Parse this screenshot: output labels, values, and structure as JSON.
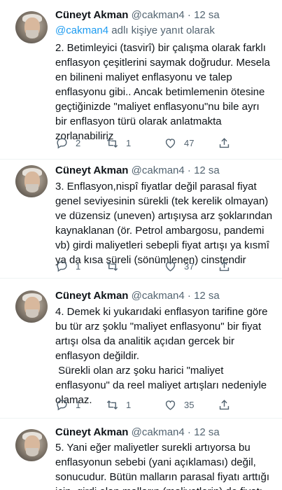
{
  "tweets": [
    {
      "name": "Cüneyt Akman",
      "handle": "@cakman4",
      "time": "· 12 sa",
      "replying_prefix": "@cakman4",
      "replying_suffix": " adlı kişiye yanıt olarak",
      "text": "2. Betimleyici (tasvirî) bir çalışma olarak farklı\nenflasyon çeşitlerini saymak doğrudur. Mesela\nen bilineni maliyet enflasyonu ve talep\nenflasyonu gibi.. Ancak betimlemenin ötesine\ngeçtiğinizde \"maliyet enflasyonu\"nu bile ayrı\nbir enflasyon türü olarak anlatmakta\nzorlanabiliriz",
      "replies": "2",
      "retweets": "1",
      "likes": "47"
    },
    {
      "name": "Cüneyt Akman",
      "handle": "@cakman4",
      "time": "· 12 sa",
      "text": "3. Enflasyon,nispî fiyatlar değil parasal fiyat\ngenel seviyesinin sürekli (tek kerelik olmayan)\nve düzensiz (uneven) artışıysa arz şoklarından\nkaynaklanan (ör. Petrol ambargosu, pandemi\nvb) girdi maliyetleri sebepli fiyat artışı ya kısmî\nya da kısa süreli (sönümlenen) cinstendir",
      "replies": "1",
      "retweets": "",
      "likes": "37"
    },
    {
      "name": "Cüneyt Akman",
      "handle": "@cakman4",
      "time": "· 12 sa",
      "text": "4. Demek ki yukarıdaki enflasyon tarifine göre\nbu tür arz şoklu \"maliyet enflasyonu\" bir fiyat\nartışı olsa da analitik açıdan gercek bir\nenflasyon değildir.\n Sürekli olan arz şoku harici \"maliyet\nenflasyonu\" da reel maliyet artışları nedeniyle\nolamaz.",
      "replies": "1",
      "retweets": "1",
      "likes": "35"
    },
    {
      "name": "Cüneyt Akman",
      "handle": "@cakman4",
      "time": "· 12 sa",
      "text": "5. Yani eğer maliyetler surekli artıyorsa bu\nenflasyonun sebebi (yani açıklaması) değil,\nsonucudur. Bütün malların parasal fiyatı arttığı\niçin, girdi olan malların (maliyetlerin) de fiyatı"
    }
  ]
}
